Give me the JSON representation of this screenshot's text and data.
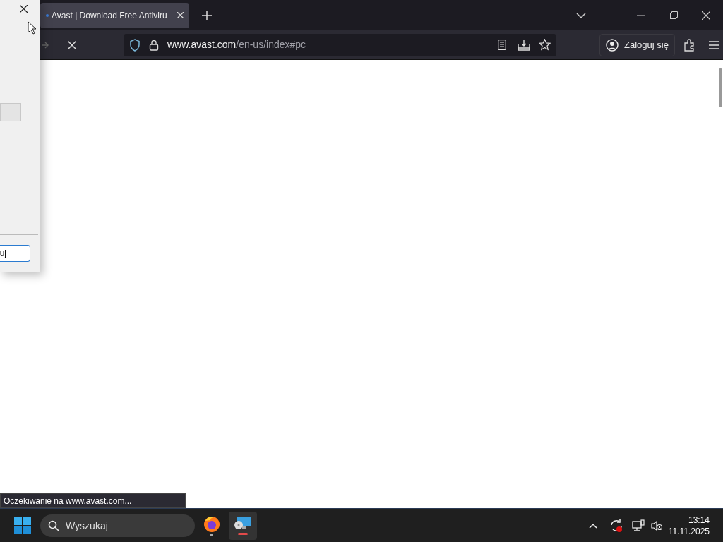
{
  "dialog": {
    "button_label": "uj"
  },
  "browser": {
    "tabs": [
      {
        "title": "Avast | Download Free Antiviru",
        "selected": true
      }
    ],
    "address": {
      "host": "www.avast.com",
      "path": "/en-us/index#pc"
    },
    "sign_in": "Zaloguj się",
    "loading": true,
    "status_text": "Oczekiwanie na www.avast.com..."
  },
  "taskbar": {
    "search_placeholder": "Wyszukaj",
    "time": "13:14",
    "date": "11.11.2025"
  }
}
